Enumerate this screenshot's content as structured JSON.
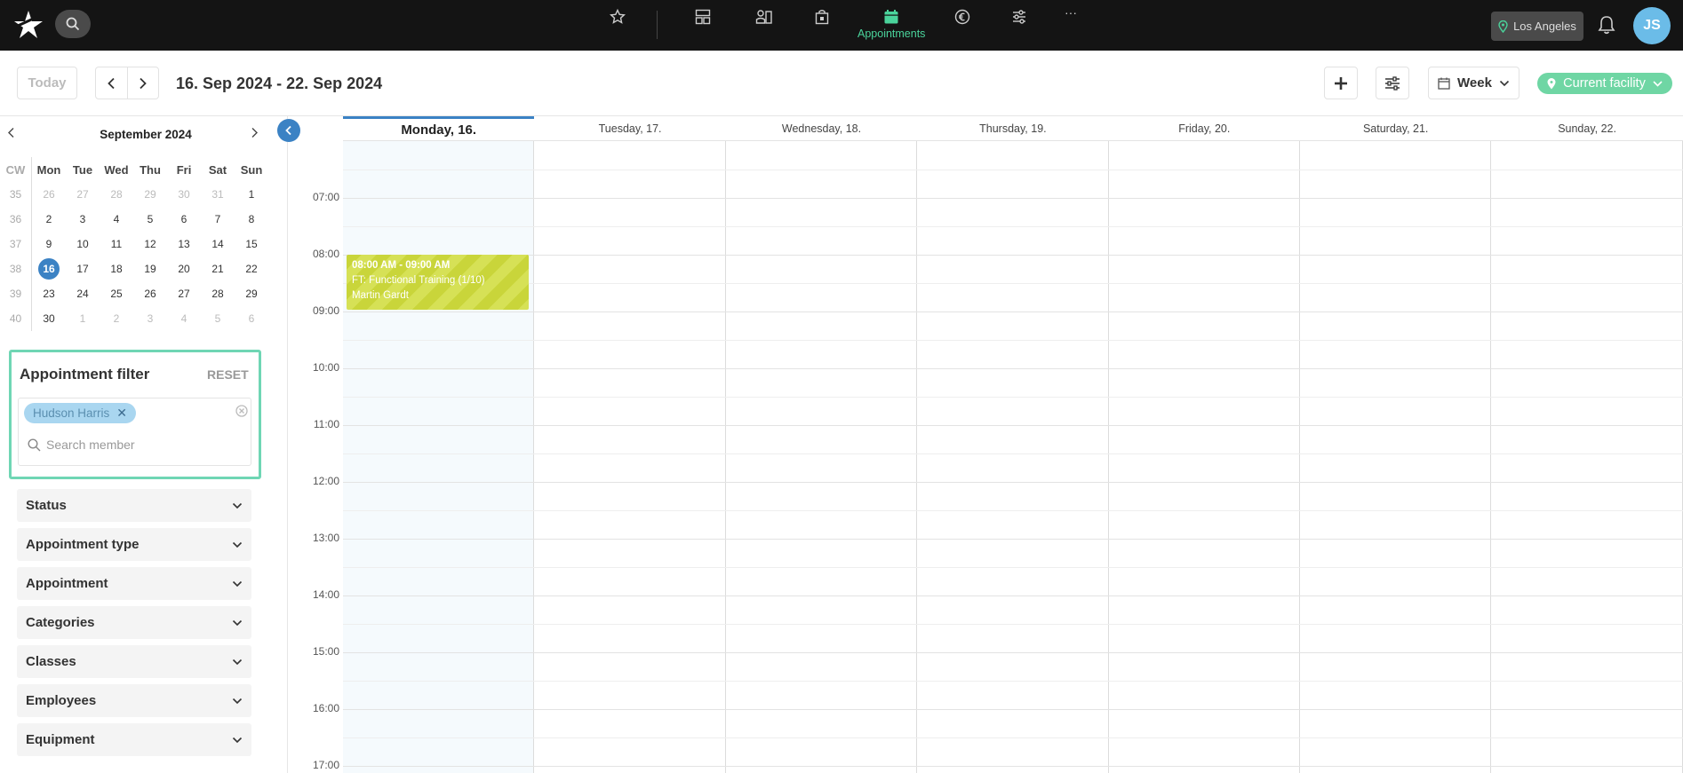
{
  "topnav": {
    "items": [
      {
        "icon": "star-icon",
        "label": ""
      },
      {
        "icon": "layout-icon",
        "label": ""
      },
      {
        "icon": "members-icon",
        "label": ""
      },
      {
        "icon": "bag-icon",
        "label": ""
      },
      {
        "icon": "calendar-icon",
        "label": "Appointments",
        "active": true
      },
      {
        "icon": "euro-icon",
        "label": ""
      },
      {
        "icon": "sliders-icon",
        "label": ""
      },
      {
        "icon": "more-icon",
        "label": "···"
      }
    ],
    "location": "Los Angeles",
    "avatar_initials": "JS"
  },
  "toolbar": {
    "today_label": "Today",
    "date_range": "16. Sep 2024 - 22. Sep 2024",
    "view_label": "Week",
    "facility_label": "Current facility"
  },
  "mini_calendar": {
    "title": "September 2024",
    "headers": [
      "CW",
      "Mon",
      "Tue",
      "Wed",
      "Thu",
      "Fri",
      "Sat",
      "Sun"
    ],
    "weeks": [
      {
        "cw": "35",
        "days": [
          "26",
          "27",
          "28",
          "29",
          "30",
          "31",
          "1"
        ],
        "dim": [
          true,
          true,
          true,
          true,
          true,
          true,
          false
        ]
      },
      {
        "cw": "36",
        "days": [
          "2",
          "3",
          "4",
          "5",
          "6",
          "7",
          "8"
        ],
        "dim": [
          false,
          false,
          false,
          false,
          false,
          false,
          false
        ]
      },
      {
        "cw": "37",
        "days": [
          "9",
          "10",
          "11",
          "12",
          "13",
          "14",
          "15"
        ],
        "dim": [
          false,
          false,
          false,
          false,
          false,
          false,
          false
        ]
      },
      {
        "cw": "38",
        "days": [
          "16",
          "17",
          "18",
          "19",
          "20",
          "21",
          "22"
        ],
        "dim": [
          false,
          false,
          false,
          false,
          false,
          false,
          false
        ]
      },
      {
        "cw": "39",
        "days": [
          "23",
          "24",
          "25",
          "26",
          "27",
          "28",
          "29"
        ],
        "dim": [
          false,
          false,
          false,
          false,
          false,
          false,
          false
        ]
      },
      {
        "cw": "40",
        "days": [
          "30",
          "1",
          "2",
          "3",
          "4",
          "5",
          "6"
        ],
        "dim": [
          false,
          true,
          true,
          true,
          true,
          true,
          true
        ]
      }
    ],
    "selected": "16"
  },
  "filter": {
    "title": "Appointment filter",
    "reset_label": "RESET",
    "chip_label": "Hudson Harris",
    "search_placeholder": "Search member",
    "sections": [
      "Status",
      "Appointment type",
      "Appointment",
      "Categories",
      "Classes",
      "Employees",
      "Equipment"
    ]
  },
  "week": {
    "days": [
      "Monday, 16.",
      "Tuesday, 17.",
      "Wednesday, 18.",
      "Thursday, 19.",
      "Friday, 20.",
      "Saturday, 21.",
      "Sunday, 22."
    ],
    "today_index": 0,
    "hours": [
      "07:00",
      "08:00",
      "09:00",
      "10:00",
      "11:00",
      "12:00",
      "13:00",
      "14:00",
      "15:00",
      "16:00",
      "17:00"
    ]
  },
  "appointment": {
    "time": "08:00 AM - 09:00 AM",
    "title": "FT: Functional Training (1/10)",
    "member": "Martin Gardt",
    "color": "#c9d53a"
  }
}
